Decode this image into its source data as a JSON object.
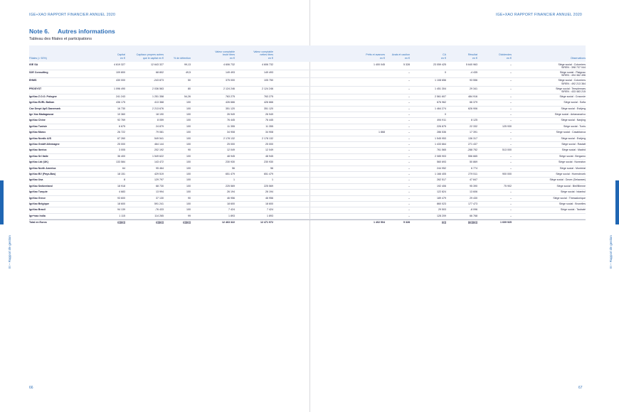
{
  "running_head_left": "IGE+XAO  RAPPORT FINANCIER ANNUEL  2020",
  "running_head_right": "IGE+XAO  RAPPORT FINANCIER ANNUEL  2020",
  "side_label": "III – Rapport de gestion",
  "page_left": "66",
  "page_right": "67",
  "note": {
    "number": "Note 6.",
    "title": "Autres informations",
    "subtitle": "Tableau des filiales et participations"
  },
  "headers": {
    "filiales": "Filiales (> 50%)",
    "capital": [
      "Capital",
      "en €"
    ],
    "capitaux": [
      "Capitaux propres autres",
      "que le capital en €"
    ],
    "detention": "% de détention",
    "brute": [
      "Valeur comptable",
      "brute titres",
      "en €"
    ],
    "nette": [
      "Valeur comptable",
      "nettes titres",
      "en €"
    ],
    "prets": [
      "Prêts et avances",
      "en €"
    ],
    "avals": [
      "Avals et caution",
      "en €"
    ],
    "ca": [
      "CA",
      "en €"
    ],
    "resultat": [
      "Résultat",
      "en €"
    ],
    "dividendes": [
      "Dividendes",
      "en €"
    ],
    "observations": "Observations"
  },
  "rows": [
    {
      "name": "IGE SA",
      "capital": "4 619 327",
      "capitaux": "12 643 327",
      "pct": "99,13",
      "brute": "4 606 732",
      "nette": "4 606 732",
      "prets": "1 400 045",
      "avals": "5 328",
      "ca": "23 059 425",
      "resultat": "5 640 963",
      "div": "–",
      "obs": [
        "Siège social : Colomiers",
        "SIREN : 398 737 044"
      ]
    },
    {
      "name": "S2E Consulting",
      "capital": "109 800",
      "capitaux": "68 802",
      "pct": "49,5",
      "brute": "149 493",
      "nette": "149 493",
      "prets": "",
      "avals": "–",
      "ca": "0",
      "resultat": "-4 435",
      "div": "–",
      "obs": [
        "Siège social : Plaignac",
        "SIREN : 494 362 496"
      ]
    },
    {
      "name": "EHMS",
      "capital": "430 000",
      "capitaux": "-243 873",
      "pct": "50",
      "brute": "375 000",
      "nette": "105 750",
      "prets": "",
      "avals": "–",
      "ca": "1 108 656",
      "resultat": "93 556",
      "div": "–",
      "obs": [
        "Siège social : Colomiers",
        "SIREN : 492 213 364"
      ]
    },
    {
      "name": "PROSYST",
      "capital": "1 096 490",
      "capitaux": "2 036 563",
      "pct": "80",
      "brute": "2 124 246",
      "nette": "2 124 246",
      "prets": "",
      "avals": "–",
      "ca": "1 451 304",
      "resultat": "29 341",
      "div": "–",
      "obs": [
        "Siège social : Templemars",
        "SIREN : 433 483 215"
      ]
    },
    {
      "name": "IgeXao Z.O.O. Pologne",
      "capital": "241 243",
      "capitaux": "1 251 358",
      "pct": "54,26",
      "brute": "763 275",
      "nette": "763 275",
      "prets": "",
      "avals": "–",
      "ca": "2 561 607",
      "resultat": "484 916",
      "div": "–",
      "obs": [
        "Siège social : Cracovie"
      ]
    },
    {
      "name": "IgeXao EURL Balkan",
      "capital": "436 175",
      "capitaux": "413 368",
      "pct": "100",
      "brute": "426 666",
      "nette": "426 666",
      "prets": "",
      "avals": "–",
      "ca": "676 962",
      "resultat": "66 379",
      "div": "–",
      "obs": [
        "Siège social : Sofia"
      ]
    },
    {
      "name": "Cae Devpt ApS Danemark",
      "capital": "16 730",
      "capitaux": "2 213 676",
      "pct": "100",
      "brute": "351 120",
      "nette": "351 120",
      "prets": "",
      "avals": "–",
      "ca": "1 464 274",
      "resultat": "626 906",
      "div": "–",
      "obs": [
        "Siège social : Esbjerg"
      ]
    },
    {
      "name": "Ige Xao Madagascar",
      "capital": "10 360",
      "capitaux": "18 190",
      "pct": "100",
      "brute": "26 949",
      "nette": "26 949",
      "prets": "",
      "avals": "–",
      "ca": "0",
      "resultat": "",
      "div": "–",
      "obs": [
        "Siège social : Antananarivo"
      ]
    },
    {
      "name": "IgeXao Chine",
      "capital": "92 769",
      "capitaux": "8 059",
      "pct": "100",
      "brute": "76 445",
      "nette": "76 445",
      "prets": "",
      "avals": "–",
      "ca": "494 911",
      "resultat": "8 125",
      "div": "–",
      "obs": [
        "Siège social : Nanjing"
      ]
    },
    {
      "name": "IgeXao Tunisie",
      "capital": "6 675",
      "capitaux": "24 879",
      "pct": "100",
      "brute": "11 355",
      "nette": "11 355",
      "prets": "",
      "avals": "–",
      "ca": "226 875",
      "resultat": "22 332",
      "div": "125 930",
      "obs": [
        "Siège social : Tunis"
      ]
    },
    {
      "name": "IgeXao Maroc",
      "capital": "26 722",
      "capitaux": "79 081",
      "pct": "100",
      "brute": "34 908",
      "nette": "34 908",
      "prets": "1 868",
      "avals": "–",
      "ca": "286 536",
      "resultat": "17 391",
      "div": "–",
      "obs": [
        "Siège social : Casablanca"
      ]
    },
    {
      "name": "IgeXao Nordic A/S",
      "capital": "67 260",
      "capitaux": "549 541",
      "pct": "100",
      "brute": "2 178 132",
      "nette": "2 178 132",
      "prets": "",
      "avals": "–",
      "ca": "1 545 953",
      "resultat": "136 317",
      "div": "–",
      "obs": [
        "Siège social : Esbjerg"
      ]
    },
    {
      "name": "IgeXao GmbH Allemagne",
      "capital": "25 000",
      "capitaux": "464 144",
      "pct": "100",
      "brute": "25 000",
      "nette": "25 000",
      "prets": "",
      "avals": "–",
      "ca": "1 433 664",
      "resultat": "271 437",
      "div": "–",
      "obs": [
        "Siège social : Rastatt"
      ]
    },
    {
      "name": "IgeXao Iberica",
      "capital": "3 005",
      "capitaux": "202 192",
      "pct": "90",
      "brute": "12 049",
      "nette": "12 049",
      "prets": "",
      "avals": "–",
      "ca": "761 565",
      "resultat": "-288 752",
      "div": "513 000",
      "obs": [
        "Siège social : Madrid"
      ]
    },
    {
      "name": "IgeXao Srl Italie",
      "capital": "36 400",
      "capitaux": "1 549 622",
      "pct": "100",
      "brute": "48 945",
      "nette": "48 945",
      "prets": "",
      "avals": "–",
      "ca": "2 085 903",
      "resultat": "556 665",
      "div": "–",
      "obs": [
        "Siège social : Bergamo"
      ]
    },
    {
      "name": "IgeXao Ltd (UK)",
      "capital": "133 584",
      "capitaux": "143 472",
      "pct": "100",
      "brute": "230 930",
      "nette": "230 930",
      "prets": "",
      "avals": "–",
      "ca": "560 693",
      "resultat": "50 869",
      "div": "–",
      "obs": [
        "Siège social : Nuneaton"
      ]
    },
    {
      "name": "IgeXao North America",
      "capital": "64",
      "capitaux": "95 464",
      "pct": "100",
      "brute": "56",
      "nette": "56",
      "prets": "",
      "avals": "–",
      "ca": "244 952",
      "resultat": "6 774",
      "div": "–",
      "obs": [
        "Siège social : Montréal"
      ]
    },
    {
      "name": "IgeXao BV (Pays-Bas)",
      "capital": "18 151",
      "capitaux": "429 519",
      "pct": "100",
      "brute": "651 479",
      "nette": "651 479",
      "prets": "",
      "avals": "–",
      "ca": "1 166 405",
      "resultat": "279 511",
      "div": "900 000",
      "obs": [
        "Siège social : Hoensbroek"
      ]
    },
    {
      "name": "IgeXao Usa",
      "capital": "8",
      "capitaux": "129 797",
      "pct": "100",
      "brute": "1",
      "nette": "1",
      "prets": "",
      "avals": "–",
      "ca": "262 517",
      "resultat": "47 847",
      "div": "",
      "obs": [
        "Siège social : Dover (Delaware)"
      ]
    },
    {
      "name": "IgeXao Switzerland",
      "capital": "18 918",
      "capitaux": "68 730",
      "pct": "100",
      "brute": "225 569",
      "nette": "225 569",
      "prets": "",
      "avals": "–",
      "ca": "192 406",
      "resultat": "95 390",
      "div": "75 902",
      "obs": [
        "Siège social : Biel/Bienne"
      ]
    },
    {
      "name": "IgeXao Turquie",
      "capital": "4 683",
      "capitaux": "13 994",
      "pct": "100",
      "brute": "26 194",
      "nette": "26 194",
      "prets": "",
      "avals": "–",
      "ca": "122 824",
      "resultat": "13 606",
      "div": "–",
      "obs": [
        "Siège social : Istanbul"
      ]
    },
    {
      "name": "IgeXao Grece",
      "capital": "93 600",
      "capitaux": "37 130",
      "pct": "90",
      "brute": "46 956",
      "nette": "46 956",
      "prets": "",
      "avals": "–",
      "ca": "189 479",
      "resultat": "29 430",
      "div": "–",
      "obs": [
        "Siège social : Thessalonique"
      ]
    },
    {
      "name": "IgeXao Belgique",
      "capital": "18 600",
      "capitaux": "591 241",
      "pct": "100",
      "brute": "18 600",
      "nette": "18 600",
      "prets": "",
      "avals": "–",
      "ca": "860 023",
      "resultat": "177 473",
      "div": "–",
      "obs": [
        "Siège social : Bruxelles"
      ]
    },
    {
      "name": "IgeXao Brasil",
      "capital": "94 139",
      "capitaux": "-76 433",
      "pct": "100",
      "brute": "7 424",
      "nette": "7 424",
      "prets": "",
      "avals": "–",
      "ca": "29 503",
      "resultat": "-8 096",
      "div": "–",
      "obs": [
        "Siège social : Taubaté"
      ]
    },
    {
      "name": "Ige+xao India",
      "capital": "1 115",
      "capitaux": "114 265",
      "pct": "99",
      "brute": "1 893",
      "nette": "1 893",
      "prets": "",
      "avals": "–",
      "ca": "128 209",
      "resultat": "66 768",
      "div": "–",
      "obs": []
    }
  ],
  "total": {
    "label": "Total en Euros",
    "capital": "(((((((((",
    "capitaux": "(((((((((",
    "pct": "(((((((((",
    "brute": "12 463 322",
    "nette": "12 471 972",
    "prets": "1 402 504",
    "avals": "5 328",
    "ca": "(((((",
    "resultat": "(((((((((((",
    "div": "1 609 925",
    "obs": ""
  }
}
